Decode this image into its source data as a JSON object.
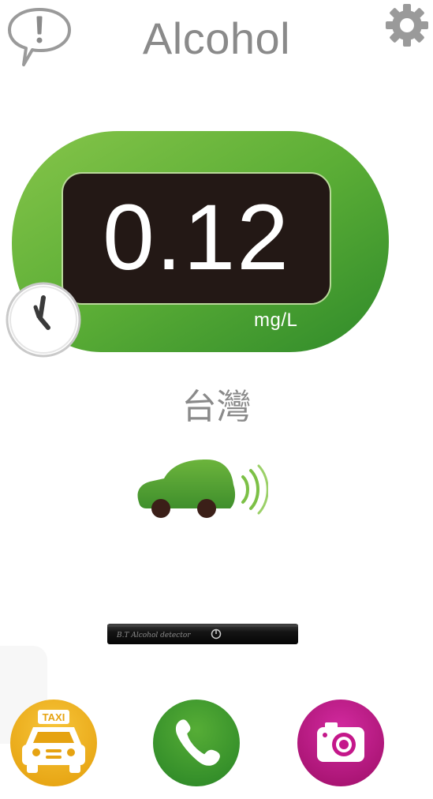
{
  "header": {
    "title": "Alcohol",
    "alert_icon": "speech-bubble-exclamation-icon",
    "settings_icon": "gear-icon"
  },
  "reading": {
    "value": "0.12",
    "unit": "mg/L"
  },
  "region": "台灣",
  "status_icon": "car-icon",
  "device_label": "B.T Alcohol detector",
  "actions": [
    {
      "name": "taxi",
      "icon": "taxi-icon",
      "label": "TAXI",
      "color": "#f0b21a"
    },
    {
      "name": "call",
      "icon": "phone-icon",
      "color": "#3f9a2c"
    },
    {
      "name": "camera",
      "icon": "camera-icon",
      "color": "#c4178a"
    }
  ],
  "colors": {
    "gauge_green": "#4ea42f",
    "gauge_green_light": "#7fc045",
    "display_bg": "#231815",
    "title_gray": "#8a8a8a"
  }
}
